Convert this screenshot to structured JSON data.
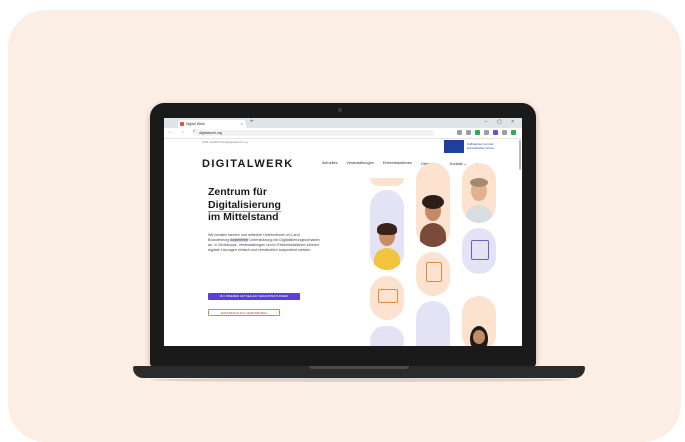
{
  "browser": {
    "tab_title": "Digital Werk",
    "tab_close": "×",
    "new_tab": "+",
    "window_controls": "– ▢ ×",
    "nav_buttons": "← → ⟳",
    "url": "digitalwerk.org",
    "extension_colors": [
      "#9aa0a6",
      "#9aa0a6",
      "#34a853",
      "#9aa0a6",
      "#6a4fd8",
      "#9aa0a6",
      "#34a853"
    ]
  },
  "site": {
    "topline": "0331 123456  info@digitalwerk.org",
    "eu_badge": "Kofinanziert von der Europäischen Union",
    "logo": "DIGITALWERK",
    "nav": [
      "Aktuelles",
      "Veranstaltungen",
      "Erlebnisstationen",
      "Über uns ⌄",
      "Kontakt ⌄"
    ],
    "search_icon": "search-icon",
    "hero_title_line1": "Zentrum für",
    "hero_title_line2": "Digitalisierung",
    "hero_title_line3": "im Mittelstand",
    "hero_body_part1": "Wir beraten kleinen und mittelere Unternehmen im Land Brandenburg ",
    "hero_body_mark": "kostenfreie",
    "hero_body_part2": " Unterstützung bei Digitalisierungsvorhaben an. In Workshops, Veranstaltungen und in Erlebnisstationen können digitale Lösungen einfach und verständlich ausprobiert werden.",
    "btn_primary": "ZU UNSEREN AKTUELLEN VERANSTALTUNGEN",
    "btn_outline": "ERSTBERATUNG VEREINBAREN"
  },
  "colors": {
    "card_bg": "#fbeee4",
    "accent_purple": "#5b3fd6",
    "accent_orange": "#e8863c",
    "pill_peach": "#fde3cf",
    "pill_lavender": "#e4e3f6"
  }
}
